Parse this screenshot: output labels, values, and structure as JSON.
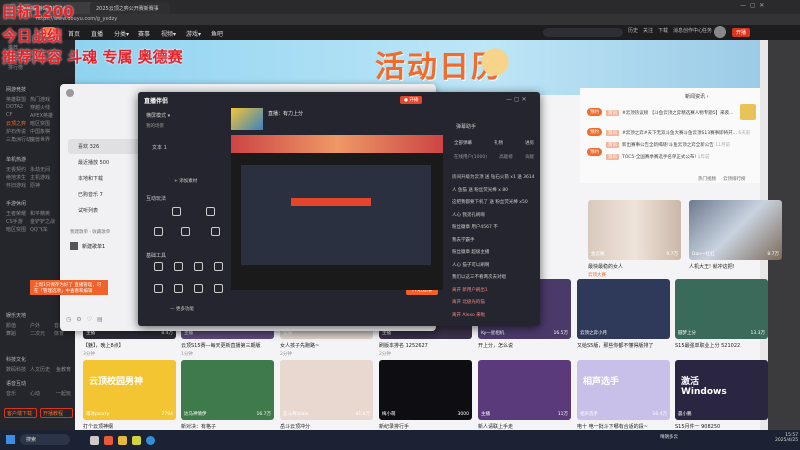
{
  "browser": {
    "tabs": [
      "斗鱼直播-游戏直播平台",
      "2025云顶之弈公开赛新赛事"
    ],
    "url": "https://www.douyu.com/g_yxdzy"
  },
  "overlay": {
    "line1": "目标1200",
    "line2": "今日战绩",
    "line3": "推荐阵容  斗魂  专属 奥德赛"
  },
  "header": {
    "nav": [
      "首页",
      "直播",
      "分类▾",
      "赛事",
      "视频▾",
      "游戏▾",
      "鱼吧"
    ],
    "icons": [
      "历史",
      "关注",
      "下载",
      "消息",
      "创作中心",
      "任务"
    ],
    "live_button": "开播"
  },
  "sidebar": {
    "top": [
      "推荐",
      "我的关注",
      "排行榜"
    ],
    "sections": [
      {
        "title": "网游竞技",
        "items": [
          "英雄联盟",
          "热门游戏",
          "DOTA2",
          "穿越火线",
          "CF",
          "APEX英雄",
          "云顶之弈",
          "暗区突围",
          "炉石传说",
          "中国象棋",
          "三角洲行动",
          "魔兽世界"
        ]
      },
      {
        "title": "单机热游",
        "items": [
          "无畏契约",
          "永劫无间",
          "绝地求生",
          "主机游戏",
          "怀旧游戏",
          "原神"
        ]
      },
      {
        "title": "手游休闲",
        "items": [
          "王者荣耀",
          "和平精英",
          "CS手游",
          "金铲铲之战",
          "暗区突围",
          "QQ飞车"
        ]
      },
      {
        "title": "娱乐天地",
        "items": [
          "颜值",
          "户外",
          "音乐",
          "舞蹈",
          "二次元",
          "体育"
        ]
      },
      {
        "title": "科技文化",
        "items": [
          "数码科技",
          "人文历史",
          "鱼教育"
        ]
      },
      {
        "title": "语音互动",
        "items": [
          "音乐",
          "心动",
          "一起玩"
        ]
      }
    ],
    "buttons": [
      "客户端下载",
      "开播教程"
    ]
  },
  "news": {
    "title": "新闻资讯 ›",
    "items": [
      {
        "tag": "资讯",
        "text": "#云顶热议榜 【斗鱼云顶之弈精选赛人物专题5】来袭...",
        "meta": ""
      },
      {
        "tag": "资讯",
        "text": "#云顶之弈#天下无双斗鱼大赛斗鱼云顶S13赛事即将开...",
        "meta": "6天前"
      },
      {
        "tag": "资讯",
        "text": "新出赛事公告全新揭晓!斗鱼云顶之弈全新公告",
        "meta": "11月前"
      },
      {
        "tag": "资讯",
        "text": "TOC5-全国赛季赛选手名单正式公布!",
        "meta": "1年前"
      }
    ],
    "left_items": [
      "预约",
      "预约",
      "预约"
    ],
    "links": [
      "热门视频",
      "云顶排行榜"
    ]
  },
  "cards_row1": [
    {
      "title": "最快最稳的女人",
      "nick": "金云阁",
      "hot": "9.7万",
      "sub": "云顶大赛"
    },
    {
      "title": "人机大王! 就冲这把!",
      "nick": "Dan一杠杠",
      "hot": "8.7万",
      "sub": ""
    }
  ],
  "cards_row2": [
    {
      "title": "【魅】，晚上8点】",
      "nick": "主播",
      "hot": "8.4万",
      "sub": "3分钟"
    },
    {
      "title": "云顶S15赛—每天更新直播第三期版",
      "nick": "主播",
      "hot": "",
      "sub": "1分钟"
    },
    {
      "title": "女人孩子先跑路~",
      "nick": "主播",
      "hot": "",
      "sub": "2分钟"
    },
    {
      "title": "刷版本排名 1252627",
      "nick": "主播",
      "hot": "",
      "sub": "2分钟"
    },
    {
      "title": "开上分，怎么说",
      "nick": "Ky一星相机",
      "hot": "16.5万",
      "sub": ""
    },
    {
      "title": "又给S5版，那些你都不懂得版排了",
      "nick": "云顶之弈小月",
      "hot": "",
      "sub": ""
    },
    {
      "title": "S15最强单职业上分 521022",
      "nick": "圆梦上分",
      "hot": "13.3万",
      "sub": ""
    }
  ],
  "cards_row3": [
    {
      "title": "打个云顶神纲",
      "nick": "雨冰psorty",
      "hot": "7794",
      "sub": "",
      "cover": "云顶校园男神"
    },
    {
      "title": "新对决：有格子",
      "nick": "达马神情伊",
      "hot": "16.7万",
      "sub": "",
      "cover": ""
    },
    {
      "title": "岳斗云顶冲分",
      "nick": "蓝斗奇lalalo",
      "hot": "41.6万",
      "sub": "3分钟",
      "cover": ""
    },
    {
      "title": "新纪录排行手",
      "nick": "梅小萌",
      "hot": "3000",
      "sub": "",
      "cover": ""
    },
    {
      "title": "新人请联上手走",
      "nick": "主播",
      "hot": "11万",
      "sub": "2分钟",
      "cover": ""
    },
    {
      "title": "电十 电一批斗下哪有合适的段~",
      "nick": "相声选手",
      "hot": "16.4万",
      "sub": "",
      "cover": "相声选手"
    },
    {
      "title": "S15月件一 908250",
      "nick": "晨小鹏",
      "hot": "",
      "sub": "3分钟",
      "cover": "激活 Windows"
    }
  ],
  "music": {
    "menu": [
      "喜欢 326",
      "最近播放 500",
      "本地和下载",
      "已购音乐 7",
      "试听列表"
    ],
    "playlist_header": "我建歌单 · 收藏歌单",
    "playlist": "新建歌单1"
  },
  "companion": {
    "title": "直播伴侣",
    "mode": "横屏模式 ▾",
    "scenes_header": "我的场景",
    "scene": "文本 1",
    "add_source": "+ 添加素材",
    "interact": "互动玩法",
    "tools": "基础工具",
    "more": "— 更多功能",
    "stream_title": "直播：有力上分",
    "start_button": "开始直播",
    "volume_a": "麦克风",
    "volume_b": "扬声器",
    "assistant": "弹幕助手",
    "tabs": [
      "全部弹幕",
      "礼物",
      "进房"
    ],
    "subtabs": [
      "在线用户(1000)",
      "高能榜",
      "贡献"
    ],
    "chat": [
      "房间升级为云顶 送 钻石火箭 x1 送 3614",
      "人 鱼猫 送 粉丝荧光棒 x 80",
      "这把我都要下机了 送 粉丝荧光棒 x50",
      "人心 我弟孔刷啊",
      "粉丝徽章 用户4567 不",
      "我去学霸手",
      "粉丝徽章 超级主播",
      "人心 猫子可以刷啊",
      "我们以这三不看两次去对唱",
      "离开 新用户刷出1",
      "离开 北极光的猫",
      "离开 Alexo 来啦"
    ]
  },
  "toast": "上周1只保存为好了 直播管理，可在「管理选项」中查看和编辑",
  "taskbar": {
    "search": "搜索",
    "weather": "晴朗多云",
    "time": "15:57",
    "date": "2025/4/25"
  }
}
